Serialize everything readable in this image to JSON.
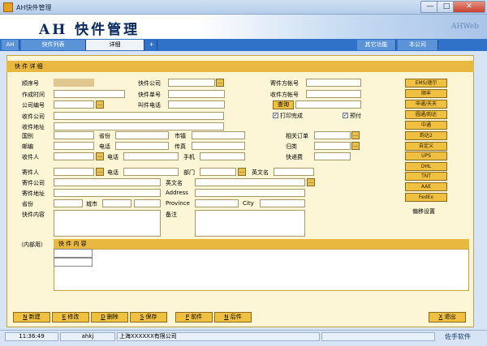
{
  "window": {
    "title": "AH快件管理",
    "min": "—",
    "max": "□",
    "close": "✕"
  },
  "banner": {
    "logo": "AH 快件管理",
    "brand": "AHWeb"
  },
  "tabs": {
    "home": "AH",
    "list": "快件列表",
    "detail": "详细",
    "add": "+",
    "other": "其它功能",
    "company": "本公司"
  },
  "panel": {
    "title": "快 件 详 细"
  },
  "fields": {
    "seq": "顺序号",
    "created": "作成时间",
    "company_no": "公司编号",
    "recv_company": "收件公司",
    "recv_addr": "收件地址",
    "country": "国别",
    "province": "省份",
    "city": "市镇",
    "order": "相关订单",
    "zip": "邮编",
    "phone": "电话",
    "fax": "传真",
    "category": "归类",
    "receiver": "收件人",
    "phone2": "电话",
    "mobile": "手机",
    "express_fee": "快递费",
    "courier_co": "快件公司",
    "courier_no": "快件单号",
    "caller_phone": "叫件电话",
    "sender_acct": "寄件方帐号",
    "recv_acct": "收件方帐号",
    "query": "查询",
    "printed": "打印完成",
    "paid": "预付",
    "sender": "寄件人",
    "sphone": "电话",
    "dept": "部门",
    "en_name": "英文名",
    "send_company": "寄件公司",
    "en_name2": "英文名",
    "send_addr": "寄件地址",
    "address": "Address",
    "sprovince": "省份",
    "scity": "城市",
    "province_en": "Province",
    "city_en": "City",
    "content": "快件内容",
    "note": "备注"
  },
  "right_buttons": [
    "EMS/速尔",
    "顺丰",
    "申通/天天",
    "圆通/韵达",
    "中通",
    "韵达2",
    "自定义",
    "UPS",
    "DHL",
    "TNT",
    "AAE",
    "FedEx"
  ],
  "right_link": "偏移设置",
  "internal": {
    "label": "（内部用）",
    "header": "快 件 内 容"
  },
  "bottom": {
    "new": "新建",
    "edit": "修改",
    "del": "删除",
    "save": "保存",
    "prev": "前件",
    "next": "后件",
    "exit": "退出"
  },
  "bottom_keys": {
    "new": "N",
    "edit": "E",
    "del": "D",
    "save": "S",
    "prev": "P",
    "next": "N",
    "exit": "X"
  },
  "status": {
    "time": "11:36:49",
    "user": "ahkj",
    "company": "上海XXXXXX有限公司",
    "vendor": "佐手软件"
  }
}
